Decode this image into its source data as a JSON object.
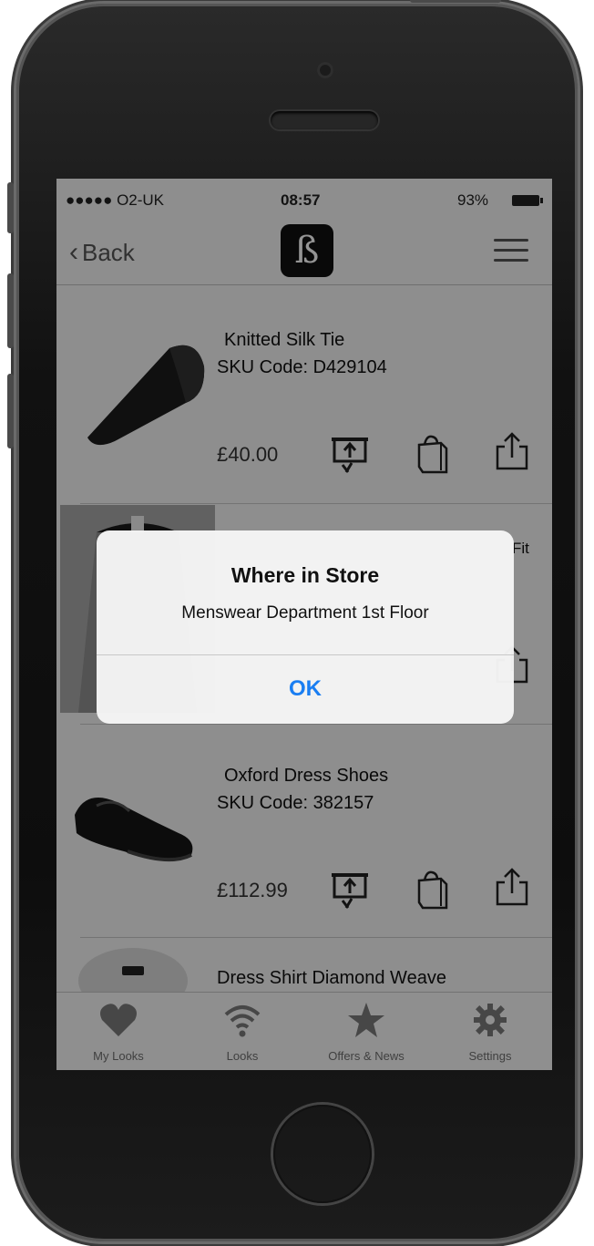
{
  "status_bar": {
    "carrier": "●●●●● O2-UK",
    "time": "08:57",
    "battery": "93%"
  },
  "navbar": {
    "back_label": "Back",
    "logo_glyph": "ß"
  },
  "products": [
    {
      "name": "Knitted Silk Tie",
      "sku": "SKU Code: D429104",
      "price": "£40.00"
    },
    {
      "name_fragment": "Fit"
    },
    {
      "name": "Oxford Dress Shoes",
      "sku": "SKU Code: 382157",
      "price": "£112.99"
    },
    {
      "name": "Dress Shirt Diamond Weave"
    }
  ],
  "tabs": [
    {
      "label": "My Looks",
      "icon": "heart-icon"
    },
    {
      "label": "Looks",
      "icon": "wifi-icon"
    },
    {
      "label": "Offers & News",
      "icon": "star-icon"
    },
    {
      "label": "Settings",
      "icon": "gear-icon"
    }
  ],
  "alert": {
    "title": "Where in Store",
    "message": "Menswear Department 1st Floor",
    "ok_label": "OK"
  },
  "colors": {
    "accent": "#1a7ef2",
    "tab_icon": "#7a7a7a"
  }
}
